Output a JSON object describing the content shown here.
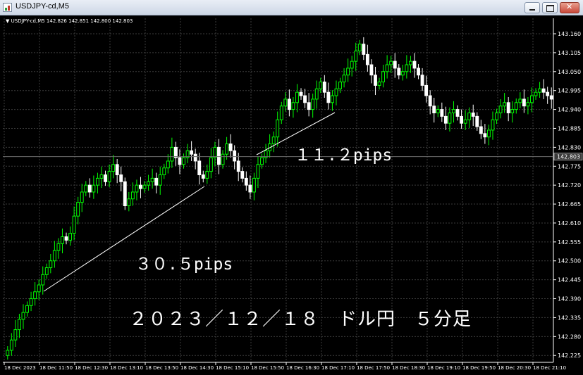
{
  "window": {
    "title": "USDJPY-cd,M5"
  },
  "symbol_bar": {
    "triangle": "▼",
    "text": "USDJPY-cd,M5  142.826 142.851 142.800 142.803"
  },
  "colors": {
    "background": "#000000",
    "grid": "#3c3c3c",
    "bull": "#00ff00",
    "bear": "#ffffff",
    "text": "#ffffff"
  },
  "annotations": [
    {
      "text": "３０.５pips"
    },
    {
      "text": "１１.２pips"
    },
    {
      "text": "２０２３／１２／１８　ドル円　５分足"
    }
  ],
  "chart_data": {
    "type": "candlestick",
    "ylim": [
      142.205,
      143.205
    ],
    "current_price": 142.803,
    "y_ticks": [
      143.16,
      143.105,
      143.05,
      142.995,
      142.94,
      142.885,
      142.83,
      142.775,
      142.72,
      142.665,
      142.61,
      142.555,
      142.5,
      142.445,
      142.39,
      142.335,
      142.28,
      142.225
    ],
    "x_ticks": [
      "18 Dec 2023",
      "18 Dec 11:50",
      "18 Dec 12:30",
      "18 Dec 13:10",
      "18 Dec 13:50",
      "18 Dec 14:30",
      "18 Dec 15:10",
      "18 Dec 15:50",
      "18 Dec 16:30",
      "18 Dec 17:10",
      "18 Dec 17:50",
      "18 Dec 18:30",
      "18 Dec 19:10",
      "18 Dec 19:50",
      "18 Dec 20:30",
      "18 Dec 21:10"
    ],
    "closes": [
      142.24,
      142.27,
      142.3,
      142.33,
      142.35,
      142.37,
      142.39,
      142.41,
      142.43,
      142.46,
      142.48,
      142.5,
      142.53,
      142.55,
      142.57,
      142.56,
      142.58,
      142.63,
      142.67,
      142.7,
      142.72,
      142.7,
      142.72,
      142.74,
      142.75,
      142.73,
      142.76,
      142.78,
      142.75,
      142.73,
      142.66,
      142.68,
      142.7,
      142.72,
      142.71,
      142.72,
      142.73,
      142.74,
      142.72,
      142.75,
      142.77,
      142.79,
      142.83,
      142.8,
      142.78,
      142.8,
      142.82,
      142.81,
      142.79,
      142.75,
      142.74,
      142.76,
      142.8,
      142.83,
      142.78,
      142.81,
      142.84,
      142.82,
      142.79,
      142.76,
      142.74,
      142.72,
      142.7,
      142.74,
      142.78,
      142.8,
      142.82,
      142.84,
      142.86,
      142.91,
      142.95,
      142.97,
      142.94,
      142.96,
      142.99,
      142.98,
      142.96,
      142.94,
      142.97,
      143.0,
      143.02,
      142.99,
      142.96,
      142.98,
      143.0,
      143.02,
      143.04,
      143.06,
      143.08,
      143.11,
      143.13,
      143.1,
      143.07,
      143.04,
      143.01,
      143.02,
      143.05,
      143.07,
      143.08,
      143.06,
      143.04,
      143.05,
      143.07,
      143.08,
      143.06,
      143.04,
      143.01,
      142.98,
      142.95,
      142.93,
      142.94,
      142.92,
      142.9,
      142.93,
      142.94,
      142.92,
      142.9,
      142.91,
      142.93,
      142.92,
      142.89,
      142.87,
      142.86,
      142.88,
      142.91,
      142.93,
      142.95,
      142.96,
      142.93,
      142.94,
      142.96,
      142.97,
      142.95,
      142.96,
      142.98,
      142.99,
      143.0,
      142.99,
      142.98,
      142.97
    ]
  }
}
